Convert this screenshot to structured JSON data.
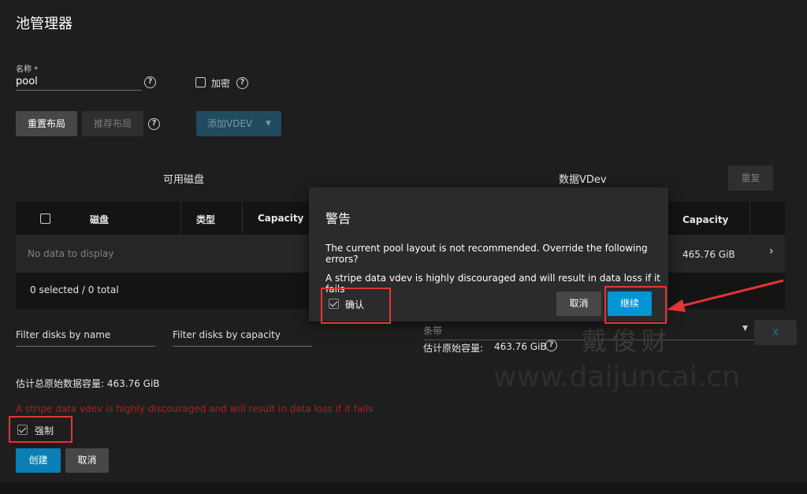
{
  "page": {
    "title": "池管理器",
    "name_label": "名称 *",
    "name_value": "pool",
    "encrypt_label": "加密",
    "reset_layout_label": "重置布局",
    "suggest_layout_label": "推荐布局",
    "add_vdev_label": "添加VDEV",
    "available_disks_title": "可用磁盘",
    "data_vdev_title": "数据VDev",
    "repeat_label": "重复",
    "table_headers": [
      "磁盘",
      "类型",
      "Capacity"
    ],
    "vdev_capacity_header": "Capacity",
    "no_data": "No data to display",
    "vdev_capacity_value": "465.76 GiB",
    "selection_summary": "0 selected / 0 total",
    "filter_name_placeholder": "Filter disks by name",
    "filter_capacity_placeholder": "Filter disks by capacity",
    "vdev_type": "条带",
    "vdev_estimate_label": "估计原始容量:",
    "vdev_estimate_value": "463.76 GiB",
    "vdev_remove": "X",
    "total_estimate": "估计总原始数据容量: 463.76 GiB",
    "error_message": "A stripe data vdev is highly discouraged and will result in data loss if it fails",
    "force_label": "强制",
    "create_label": "创建",
    "cancel_label": "取消"
  },
  "dialog": {
    "title": "警告",
    "message_line1": "The current pool layout is not recommended. Override the following errors?",
    "message_line2": "A stripe data vdev is highly discouraged and will result in data loss if it fails",
    "confirm_label": "确认",
    "cancel_label": "取消",
    "continue_label": "继续"
  },
  "watermark": {
    "chinese": "戴俊财",
    "url": "www.daijuncai.cn"
  },
  "colors": {
    "accent": "#0095d5",
    "annotation": "#e23535",
    "error": "#b01e1e"
  }
}
